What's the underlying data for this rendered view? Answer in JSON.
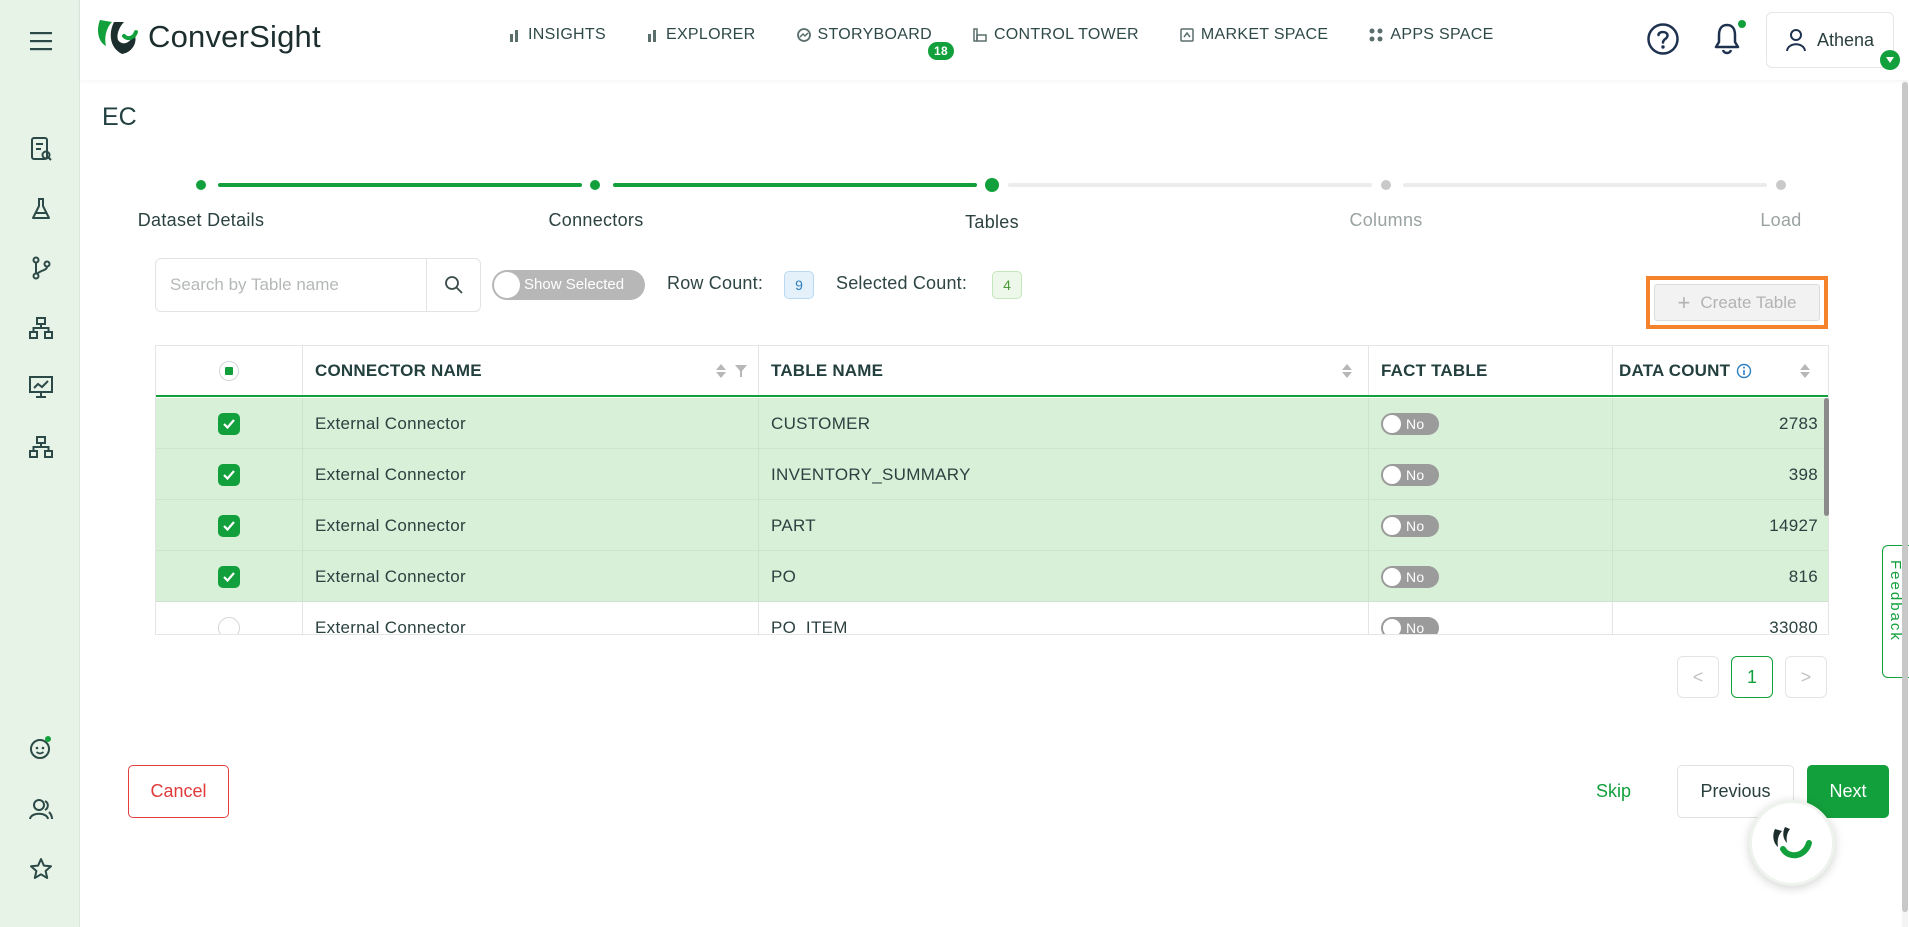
{
  "app": {
    "brand": "ConverSight"
  },
  "nav": {
    "items": [
      {
        "label": "INSIGHTS",
        "icon": "bar-chart-icon"
      },
      {
        "label": "EXPLORER",
        "icon": "bar-chart-icon"
      },
      {
        "label": "STORYBOARD",
        "icon": "storyboard-icon",
        "badge": "18"
      },
      {
        "label": "CONTROL TOWER",
        "icon": "tower-icon"
      },
      {
        "label": "MARKET SPACE",
        "icon": "store-icon"
      },
      {
        "label": "APPS SPACE",
        "icon": "grid-icon"
      }
    ]
  },
  "user": {
    "name": "Athena"
  },
  "page": {
    "title": "EC"
  },
  "stepper": {
    "steps": [
      {
        "label": "Dataset Details",
        "state": "done"
      },
      {
        "label": "Connectors",
        "state": "done"
      },
      {
        "label": "Tables",
        "state": "current"
      },
      {
        "label": "Columns",
        "state": "pending"
      },
      {
        "label": "Load",
        "state": "pending"
      }
    ]
  },
  "toolbar": {
    "search_placeholder": "Search by Table name",
    "show_selected_label": "Show Selected",
    "row_count_label": "Row Count:",
    "row_count": "9",
    "selected_count_label": "Selected Count:",
    "selected_count": "4",
    "create_table_label": "Create Table"
  },
  "table": {
    "headers": {
      "connector_name": "CONNECTOR NAME",
      "table_name": "TABLE NAME",
      "fact_table": "FACT TABLE",
      "data_count": "DATA COUNT"
    },
    "rows": [
      {
        "selected": true,
        "connector": "External Connector",
        "table": "CUSTOMER",
        "fact": "No",
        "count": "2783"
      },
      {
        "selected": true,
        "connector": "External Connector",
        "table": "INVENTORY_SUMMARY",
        "fact": "No",
        "count": "398"
      },
      {
        "selected": true,
        "connector": "External Connector",
        "table": "PART",
        "fact": "No",
        "count": "14927"
      },
      {
        "selected": true,
        "connector": "External Connector",
        "table": "PO",
        "fact": "No",
        "count": "816"
      },
      {
        "selected": false,
        "connector": "External Connector",
        "table": "PO_ITEM",
        "fact": "No",
        "count": "33080"
      }
    ]
  },
  "pagination": {
    "current_page": "1",
    "prev": "<",
    "next": ">"
  },
  "footer": {
    "cancel_label": "Cancel",
    "skip_label": "Skip",
    "previous_label": "Previous",
    "next_label": "Next"
  },
  "feedback": {
    "label": "Feedback"
  },
  "colors": {
    "accent": "#12a03c",
    "highlight": "#f5832b",
    "selected_row": "#d8efd8",
    "sidebar_bg": "#e8f3e8"
  }
}
